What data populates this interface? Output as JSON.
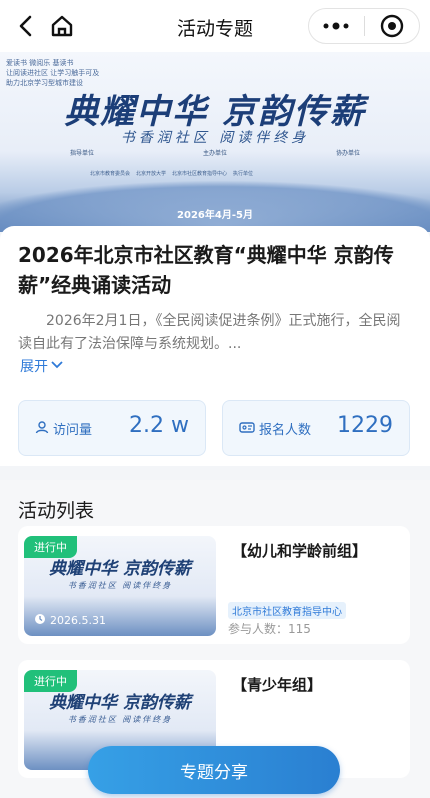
{
  "nav": {
    "title": "活动专题"
  },
  "banner": {
    "corner_text": "爱读书 微阅乐 基读书",
    "corner_text_2": "让阅读进社区 让学习触手可及",
    "corner_text_3": "助力北京学习型城市建设",
    "headline": "典耀中华 京韵传薪",
    "subline": "书香润社区 阅读伴终身",
    "org_labels": [
      "指导单位",
      "主办单位",
      "协办单位"
    ],
    "org_names": [
      "北京市教育委员会",
      "北京开放大学",
      "北京市社区教育指导中心"
    ],
    "support_label": "执行单位",
    "date": "2026年4月-5月"
  },
  "detail": {
    "title": "2026年北京市社区教育“典耀中华 京韵传薪”经典诵读活动",
    "description": "2026年2月1日，《全民阅读促进条例》正式施行，全民阅读自此有了法治保障与系统规划。...",
    "expand_label": "展开",
    "visits_label": "访问量",
    "visits_value": "2.2 w",
    "signups_label": "报名人数",
    "signups_value": "1229"
  },
  "list": {
    "heading": "活动列表",
    "items": [
      {
        "status": "进行中",
        "thumb_title": "典耀中华 京韵传薪",
        "thumb_sub": "书香润社区 阅读伴终身",
        "date": "2026.5.31",
        "name": "【幼儿和学龄前组】",
        "org": "北京市社区教育指导中心",
        "participants": "参与人数：115"
      },
      {
        "status": "进行中",
        "thumb_title": "典耀中华 京韵传薪",
        "thumb_sub": "书香润社区 阅读伴终身",
        "date": "",
        "name": "【青少年组】",
        "org": "",
        "participants": ""
      }
    ]
  },
  "share_button": "专题分享",
  "colors": {
    "accent": "#2f7ad8",
    "status_green": "#21c07a"
  },
  "icons": [
    "back-arrow-icon",
    "home-icon",
    "more-dots-icon",
    "close-target-icon",
    "user-icon",
    "ticket-icon",
    "clock-icon",
    "chevron-down-icon"
  ]
}
